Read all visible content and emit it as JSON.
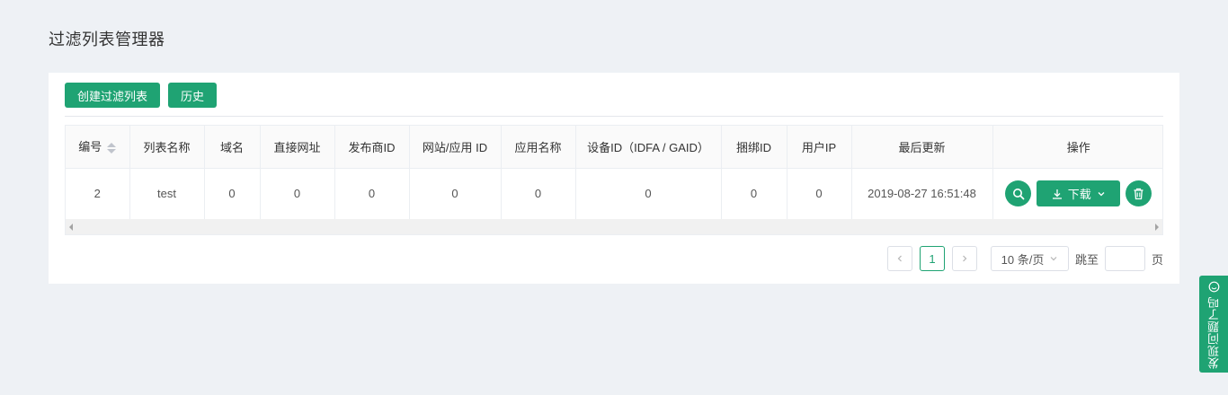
{
  "page": {
    "title": "过滤列表管理器"
  },
  "toolbar": {
    "create_label": "创建过滤列表",
    "history_label": "历史"
  },
  "table": {
    "headers": [
      "编号",
      "列表名称",
      "域名",
      "直接网址",
      "发布商ID",
      "网站/应用 ID",
      "应用名称",
      "设备ID（IDFA / GAID）",
      "捆绑ID",
      "用户IP",
      "最后更新",
      "操作"
    ],
    "rows": [
      {
        "id": "2",
        "name": "test",
        "domain": "0",
        "url": "0",
        "publisher_id": "0",
        "site_app_id": "0",
        "app_name": "0",
        "device_id": "0",
        "bundle_id": "0",
        "user_ip": "0",
        "updated": "2019-08-27 16:51:48",
        "download_label": "下载"
      }
    ]
  },
  "pagination": {
    "current": "1",
    "page_size": "10 条/页",
    "jump_label": "跳至",
    "page_suffix": "页"
  },
  "feedback": {
    "label": "发现问题了吗"
  },
  "colors": {
    "accent": "#1fa373",
    "background": "#eef1f5"
  },
  "icons": [
    "search-icon",
    "download-icon",
    "chevron-down-icon",
    "trash-icon",
    "chevron-left-icon",
    "chevron-right-icon",
    "smile-icon",
    "sort-icon"
  ]
}
